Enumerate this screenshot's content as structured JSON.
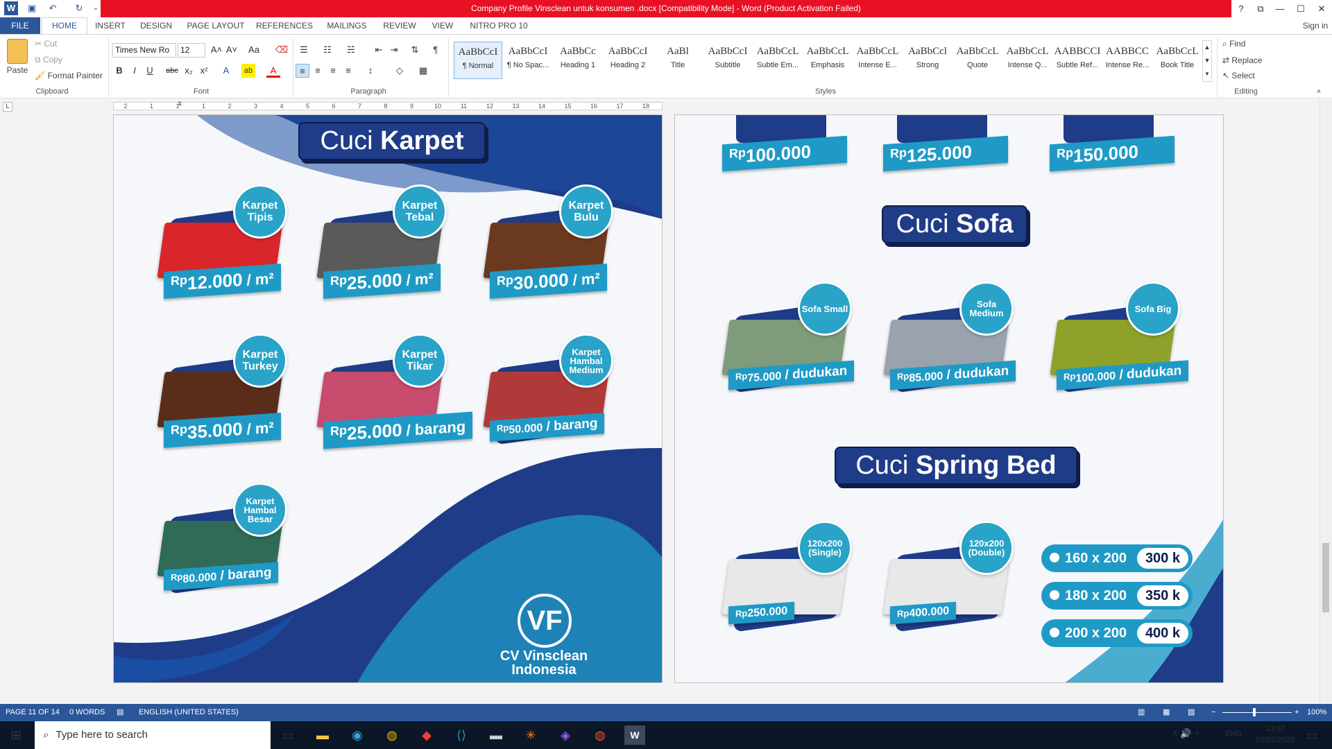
{
  "window": {
    "title": "Company Profile Vinsclean untuk konsumen .docx [Compatibility Mode]  -  Word (Product Activation Failed)",
    "sign_in": "Sign in",
    "help": "?",
    "restore_ribbon": "⧉",
    "minimize": "—",
    "maximize": "☐",
    "close": "✕"
  },
  "qat": {
    "word": "W",
    "save": "💾",
    "undo": "↶",
    "redo": "↻",
    "customize": "⌄"
  },
  "tabs": [
    "FILE",
    "HOME",
    "INSERT",
    "DESIGN",
    "PAGE LAYOUT",
    "REFERENCES",
    "MAILINGS",
    "REVIEW",
    "VIEW",
    "NITRO PRO 10"
  ],
  "clipboard": {
    "paste": "Paste",
    "cut": "Cut",
    "copy": "Copy",
    "format_painter": "Format Painter",
    "group": "Clipboard"
  },
  "font": {
    "name": "Times New Ro",
    "size": "12",
    "grow": "A˄",
    "shrink": "A˅",
    "case": "Aa",
    "clear": "⌫",
    "bold": "B",
    "italic": "I",
    "underline": "U",
    "strike": "abc",
    "sub": "x₂",
    "sup": "x²",
    "effects": "A",
    "highlight": "ab",
    "color": "A",
    "group": "Font"
  },
  "paragraph": {
    "bullets": "☰",
    "numbering": "☷",
    "multilevel": "☵",
    "decrease": "⇤",
    "increase": "⇥",
    "sort": "⇅",
    "pilcrow": "¶",
    "left": "≡",
    "center": "≡",
    "right": "≡",
    "justify": "≡",
    "spacing": "↕",
    "shading": "◇",
    "borders": "▦",
    "group": "Paragraph"
  },
  "styles": {
    "group": "Styles",
    "items": [
      {
        "preview": "AaBbCcI",
        "name": "¶ Normal"
      },
      {
        "preview": "AaBbCcI",
        "name": "¶ No Spac..."
      },
      {
        "preview": "AaBbCc",
        "name": "Heading 1"
      },
      {
        "preview": "AaBbCcI",
        "name": "Heading 2"
      },
      {
        "preview": "AaBl",
        "name": "Title"
      },
      {
        "preview": "AaBbCcI",
        "name": "Subtitle"
      },
      {
        "preview": "AaBbCcL",
        "name": "Subtle Em..."
      },
      {
        "preview": "AaBbCcL",
        "name": "Emphasis"
      },
      {
        "preview": "AaBbCcL",
        "name": "Intense E..."
      },
      {
        "preview": "AaBbCcl",
        "name": "Strong"
      },
      {
        "preview": "AaBbCcL",
        "name": "Quote"
      },
      {
        "preview": "AaBbCcL",
        "name": "Intense Q..."
      },
      {
        "preview": "AABBCCI",
        "name": "Subtle Ref..."
      },
      {
        "preview": "AABBCC",
        "name": "Intense Re..."
      },
      {
        "preview": "AaBbCcL",
        "name": "Book Title"
      }
    ]
  },
  "editing": {
    "find": "Find",
    "replace": "Replace",
    "select": "Select",
    "group": "Editing"
  },
  "ruler": [
    "2",
    "1",
    "1",
    "1",
    "2",
    "3",
    "4",
    "5",
    "6",
    "7",
    "8",
    "9",
    "10",
    "11",
    "12",
    "13",
    "14",
    "15",
    "16",
    "17",
    "18"
  ],
  "page_left": {
    "title_light": "Cuci",
    "title_bold": "Karpet",
    "items": [
      {
        "label": "Karpet Tipis",
        "rp": "Rp",
        "price": "12.000",
        "unit": " / m²"
      },
      {
        "label": "Karpet Tebal",
        "rp": "Rp",
        "price": "25.000",
        "unit": " / m²"
      },
      {
        "label": "Karpet Bulu",
        "rp": "Rp",
        "price": "30.000",
        "unit": " / m²"
      },
      {
        "label": "Karpet Turkey",
        "rp": "Rp",
        "price": "35.000",
        "unit": " / m²"
      },
      {
        "label": "Karpet Tikar",
        "rp": "Rp",
        "price": "25.000",
        "unit": " / barang"
      },
      {
        "label": "Karpet Hambal Medium",
        "rp": "Rp",
        "price": "50.000",
        "unit": " / barang"
      },
      {
        "label": "Karpet Hambal Besar",
        "rp": "Rp",
        "price": "80.000",
        "unit": " / barang"
      }
    ],
    "company_line1": "CV Vinsclean",
    "company_line2": "Indonesia"
  },
  "page_right": {
    "top_prices": [
      {
        "rp": "Rp",
        "price": "100.000"
      },
      {
        "rp": "Rp",
        "price": "125.000"
      },
      {
        "rp": "Rp",
        "price": "150.000"
      }
    ],
    "sofa_light": "Cuci",
    "sofa_bold": "Sofa",
    "sofas": [
      {
        "label": "Sofa Small",
        "rp": "Rp",
        "price": "75.000",
        "unit": " / dudukan"
      },
      {
        "label": "Sofa Medium",
        "rp": "Rp",
        "price": "85.000",
        "unit": " / dudukan"
      },
      {
        "label": "Sofa Big",
        "rp": "Rp",
        "price": "100.000",
        "unit": " / dudukan"
      }
    ],
    "bed_light": "Cuci",
    "bed_bold": "Spring Bed",
    "beds": [
      {
        "label": "120x200 (Single)",
        "rp": "Rp",
        "price": "250.000"
      },
      {
        "label": "120x200 (Double)",
        "rp": "Rp",
        "price": "400.000"
      }
    ],
    "bed_sizes": [
      {
        "size": "160 x 200",
        "price": "300 k"
      },
      {
        "size": "180 x 200",
        "price": "350 k"
      },
      {
        "size": "200 x 200",
        "price": "400 k"
      }
    ]
  },
  "status": {
    "page": "PAGE 11 OF 14",
    "words": "0 WORDS",
    "language": "ENGLISH (UNITED STATES)",
    "zoom": "100%"
  },
  "taskbar": {
    "search": "Type here to search",
    "time": "13:07",
    "date": "02/03/2023",
    "lang": "ENG"
  },
  "colors": {
    "word_blue": "#2b579a",
    "title_red": "#e81123",
    "navy": "#1f3c88",
    "cyan": "#1f9ac6"
  }
}
